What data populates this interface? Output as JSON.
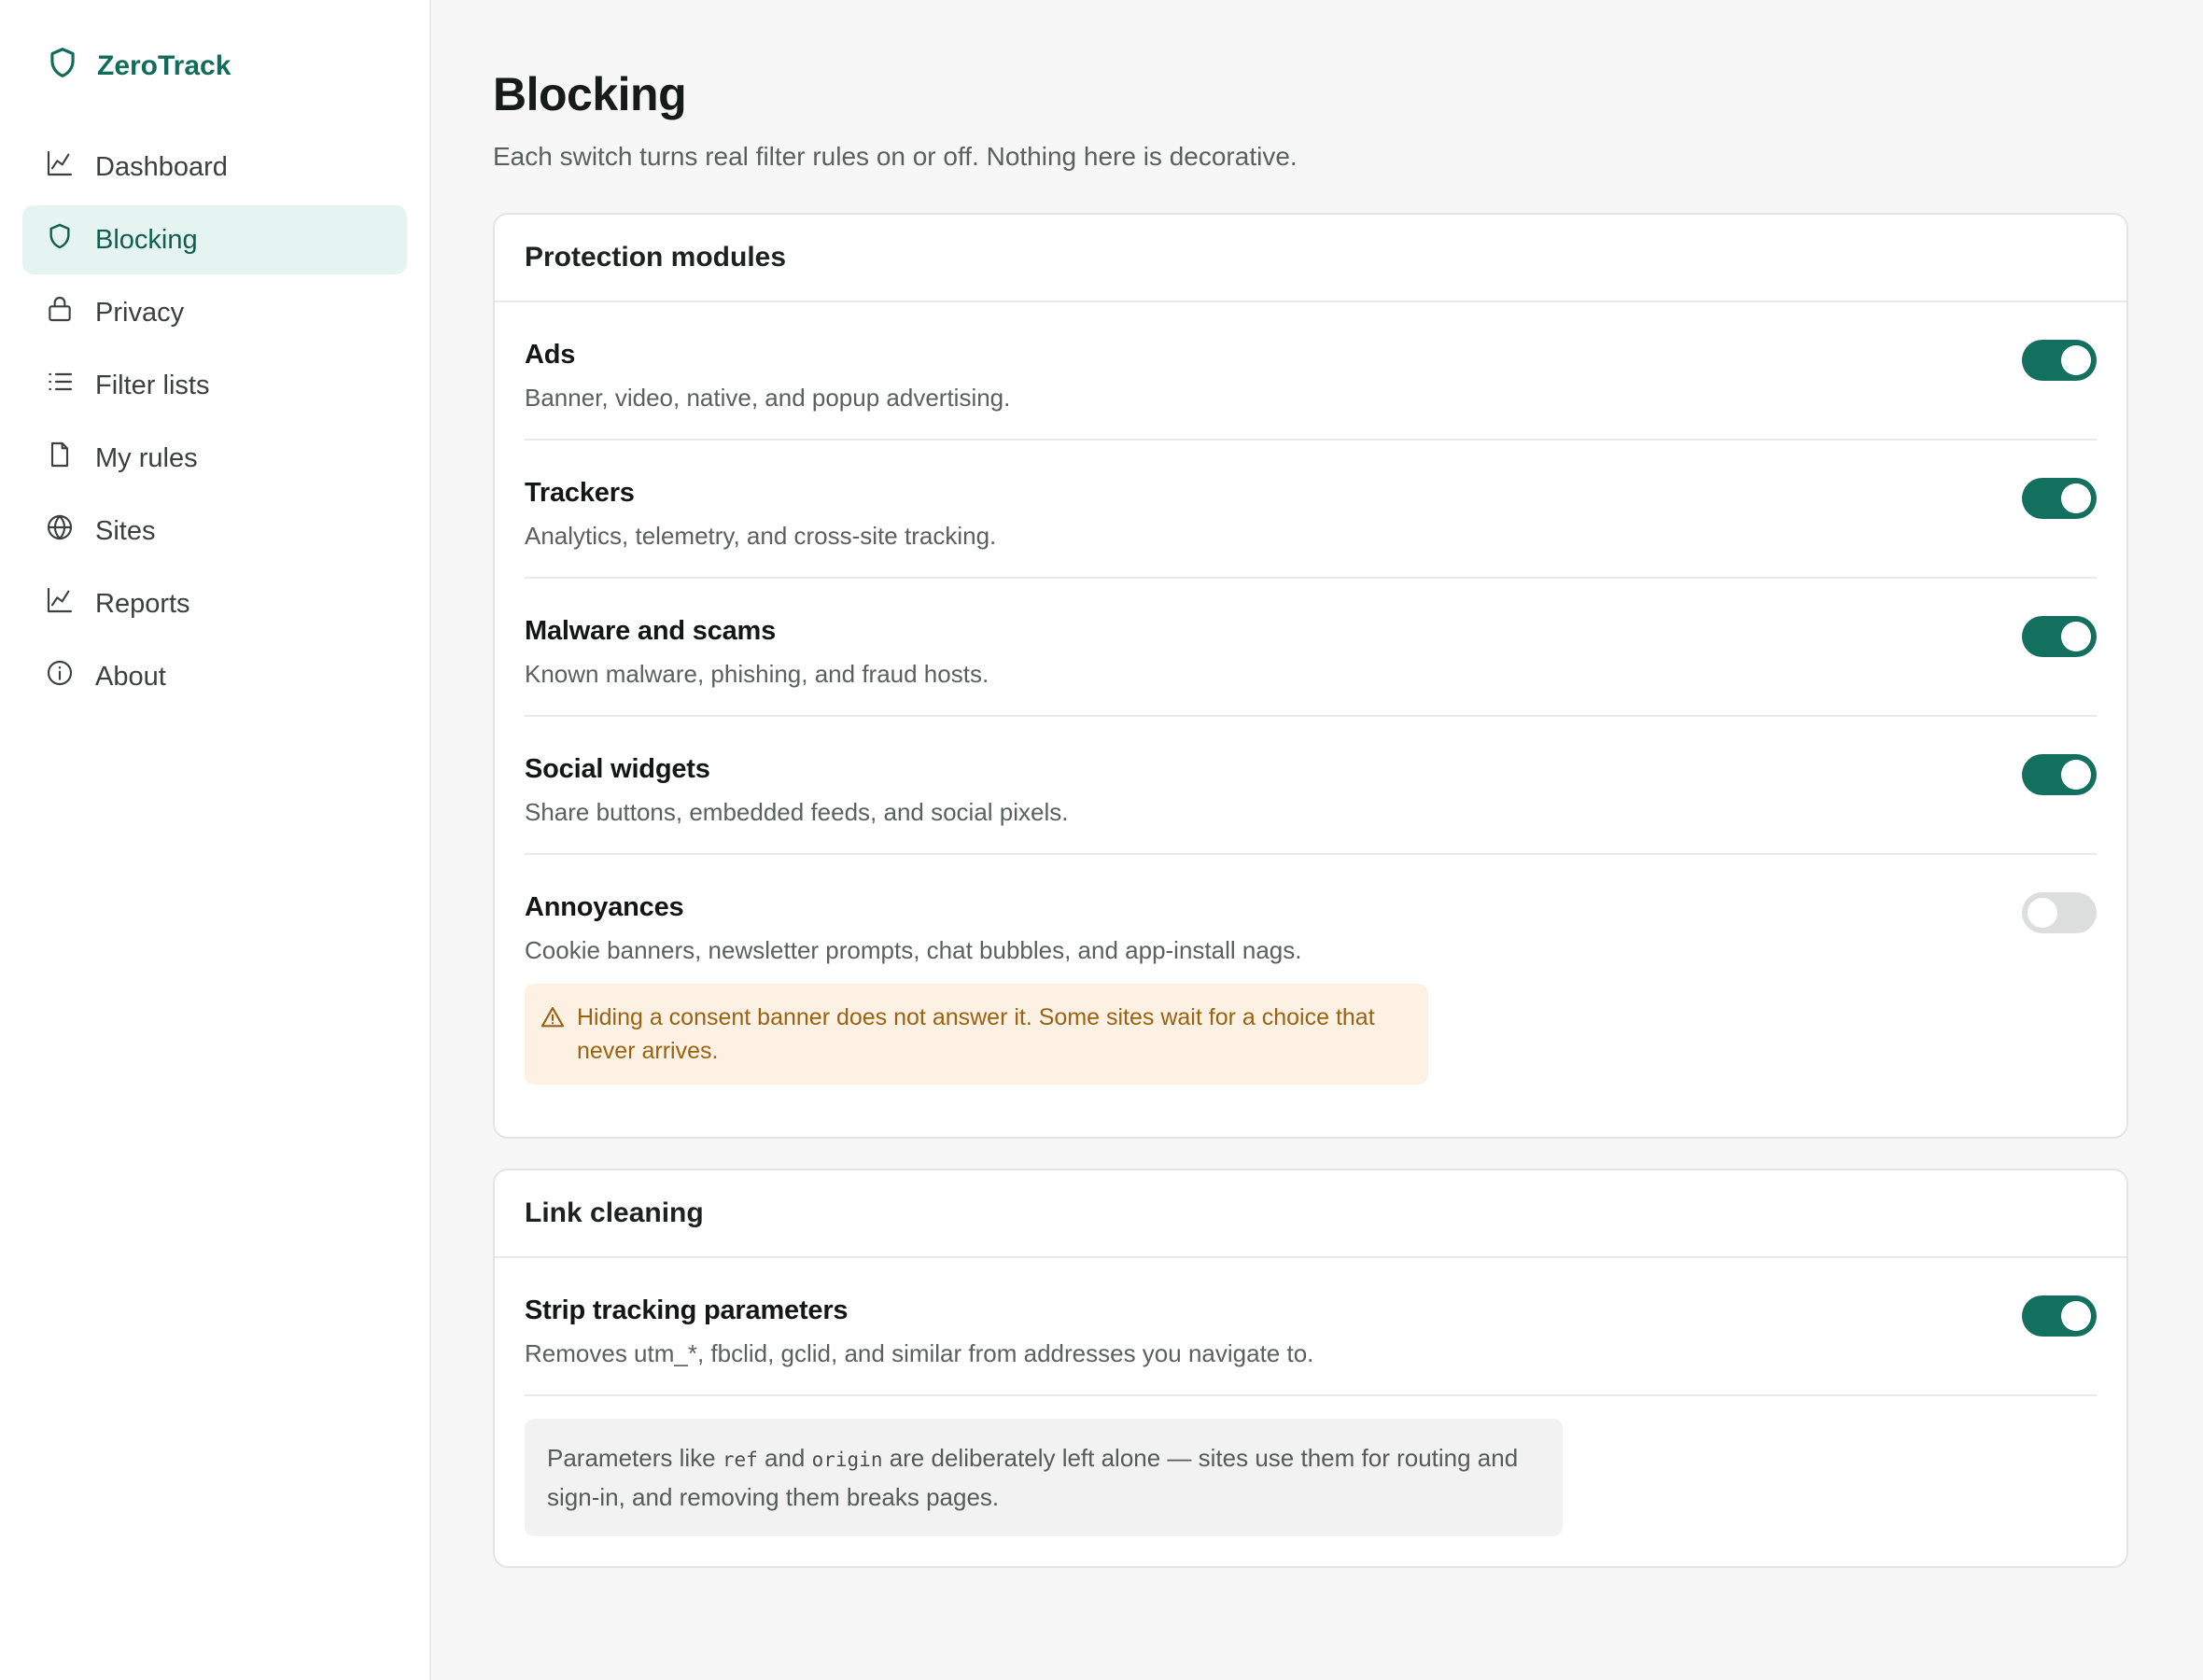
{
  "app": {
    "name": "ZeroTrack"
  },
  "sidebar": {
    "items": [
      {
        "label": "Dashboard",
        "icon": "chart-icon",
        "active": false
      },
      {
        "label": "Blocking",
        "icon": "shield-icon",
        "active": true
      },
      {
        "label": "Privacy",
        "icon": "lock-icon",
        "active": false
      },
      {
        "label": "Filter lists",
        "icon": "list-icon",
        "active": false
      },
      {
        "label": "My rules",
        "icon": "file-icon",
        "active": false
      },
      {
        "label": "Sites",
        "icon": "globe-icon",
        "active": false
      },
      {
        "label": "Reports",
        "icon": "chart-icon",
        "active": false
      },
      {
        "label": "About",
        "icon": "info-icon",
        "active": false
      }
    ]
  },
  "page": {
    "title": "Blocking",
    "subtitle": "Each switch turns real filter rules on or off. Nothing here is decorative."
  },
  "protection": {
    "header": "Protection modules",
    "modules": [
      {
        "title": "Ads",
        "description": "Banner, video, native, and popup advertising.",
        "enabled": true
      },
      {
        "title": "Trackers",
        "description": "Analytics, telemetry, and cross-site tracking.",
        "enabled": true
      },
      {
        "title": "Malware and scams",
        "description": "Known malware, phishing, and fraud hosts.",
        "enabled": true
      },
      {
        "title": "Social widgets",
        "description": "Share buttons, embedded feeds, and social pixels.",
        "enabled": true
      },
      {
        "title": "Annoyances",
        "description": "Cookie banners, newsletter prompts, chat bubbles, and app-install nags.",
        "enabled": false
      }
    ],
    "warning": "Hiding a consent banner does not answer it. Some sites wait for a choice that never arrives."
  },
  "link_cleaning": {
    "header": "Link cleaning",
    "strip": {
      "title": "Strip tracking parameters",
      "description": "Removes utm_*, fbclid, gclid, and similar from addresses you navigate to.",
      "enabled": true
    },
    "note": {
      "prefix": "Parameters like ",
      "code1": "ref",
      "middle": " and ",
      "code2": "origin",
      "suffix": " are deliberately left alone — sites use them for routing and sign-in, and removing them breaks pages."
    }
  },
  "colors": {
    "accent": "#136f5e",
    "active_nav_bg": "#e5f4f0",
    "warning_bg": "#fdf1e4",
    "warning_text": "#9a6212",
    "toggle_off": "#dcdedd"
  }
}
